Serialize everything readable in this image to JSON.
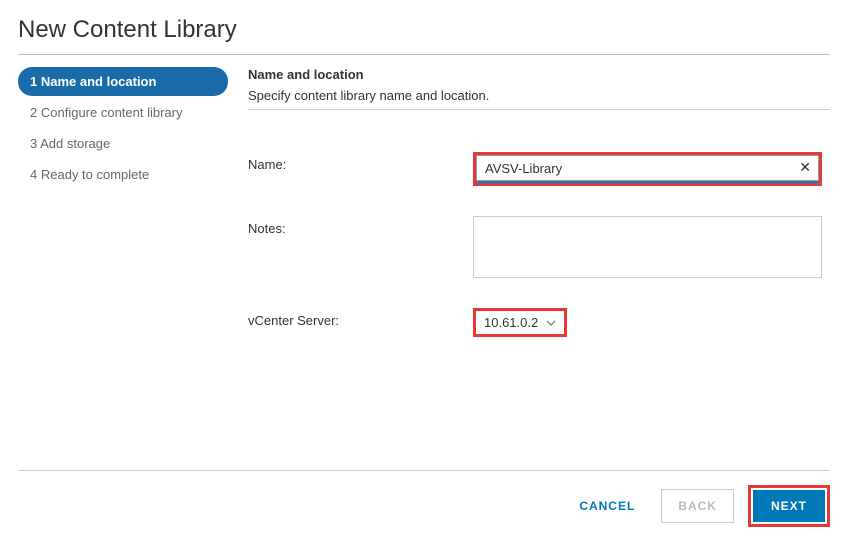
{
  "dialog": {
    "title": "New Content Library"
  },
  "steps": [
    {
      "num": "1",
      "label": "Name and location",
      "active": true
    },
    {
      "num": "2",
      "label": "Configure content library",
      "active": false
    },
    {
      "num": "3",
      "label": "Add storage",
      "active": false
    },
    {
      "num": "4",
      "label": "Ready to complete",
      "active": false
    }
  ],
  "section": {
    "title": "Name and location",
    "description": "Specify content library name and location."
  },
  "form": {
    "name_label": "Name:",
    "name_value": "AVSV-Library",
    "notes_label": "Notes:",
    "notes_value": "",
    "vcenter_label": "vCenter Server:",
    "vcenter_value": "10.61.0.2"
  },
  "buttons": {
    "cancel": "CANCEL",
    "back": "BACK",
    "next": "NEXT"
  }
}
